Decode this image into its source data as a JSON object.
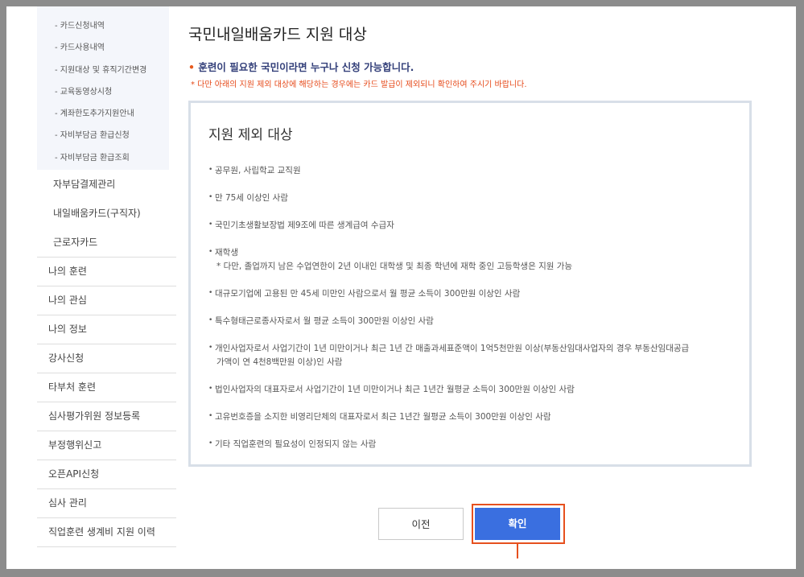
{
  "sidebar": {
    "subsub_items": [
      "- 카드신청내역",
      "- 카드사용내역",
      "- 지원대상 및 휴직기간변경",
      "- 교육동영상시청",
      "- 계좌한도추가지원안내",
      "- 자비부담금 환급신청",
      "- 자비부담금 환급조회"
    ],
    "sub_items": [
      "자부담결제관리",
      "내일배움카드(구직자)",
      "근로자카드"
    ],
    "main_items": [
      "나의 훈련",
      "나의 관심",
      "나의 정보",
      "강사신청",
      "타부처 훈련",
      "심사평가위원 정보등록",
      "부정행위신고",
      "오픈API신청",
      "심사 관리",
      "직업훈련 생계비 지원 이력"
    ]
  },
  "main": {
    "title": "국민내일배움카드 지원 대상",
    "subtitle_bullet": "•",
    "subtitle": "훈련이 필요한 국민이라면 누구나 신청 가능합니다.",
    "note": "* 다만 아래의 지원 제외 대상에 해당하는 경우에는 카드 발급이 제외되니 확인하여 주시기 바랍니다."
  },
  "exclusion": {
    "title": "지원 제외 대상",
    "items": [
      {
        "text": "공무원, 사립학교 교직원"
      },
      {
        "text": "만 75세 이상인 사람"
      },
      {
        "text": "국민기초생활보장법 제9조에 따른 생계급여 수급자"
      },
      {
        "text": "재학생",
        "sub": "* 다만, 졸업까지 남은 수업연한이 2년 이내인 대학생 및 최종 학년에 재학 중인 고등학생은 지원 가능"
      },
      {
        "text": "대규모기업에 고용된 만 45세 미만인 사람으로서 월 평균 소득이 300만원 이상인 사람"
      },
      {
        "text": "특수형태근로종사자로서 월 평균 소득이 300만원 이상인 사람"
      },
      {
        "text": "개인사업자로서 사업기간이 1년 미만이거나 최근 1년 간 매출과세표준액이 1억5천만원 이상(부동산임대사업자의 경우 부동산임대공급",
        "sub": "가액이 연 4천8백만원 이상)인 사람"
      },
      {
        "text": "법인사업자의 대표자로서 사업기간이 1년 미만이거나 최근 1년간 월평균 소득이 300만원 이상인 사람"
      },
      {
        "text": "고유번호증을 소지한 비영리단체의 대표자로서 최근 1년간 월평균 소득이 300만원 이상인 사람"
      },
      {
        "text": "기타 직업훈련의 필요성이 인정되지 않는 사람"
      }
    ]
  },
  "buttons": {
    "prev": "이전",
    "confirm": "확인"
  }
}
